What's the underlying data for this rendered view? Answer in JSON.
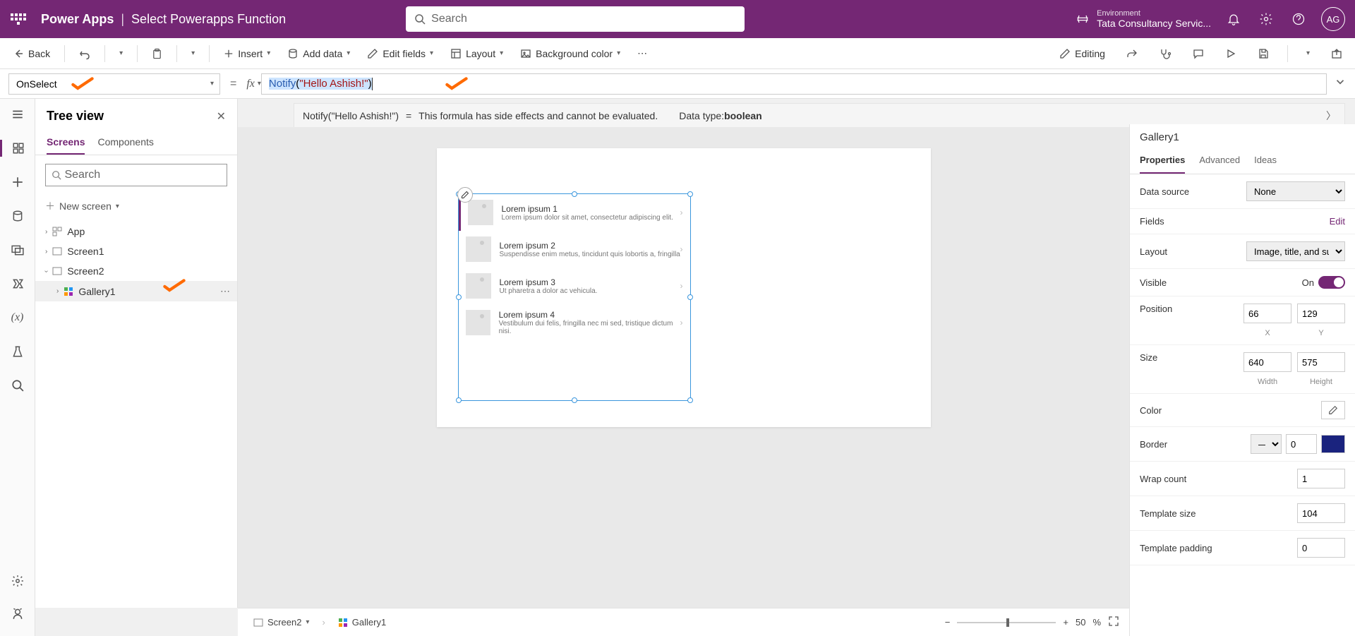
{
  "header": {
    "brand": "Power Apps",
    "title": "Select Powerapps Function",
    "search_placeholder": "Search",
    "env_label": "Environment",
    "env_value": "Tata Consultancy Servic...",
    "avatar": "AG"
  },
  "cmdbar": {
    "back": "Back",
    "insert": "Insert",
    "add_data": "Add data",
    "edit_fields": "Edit fields",
    "layout": "Layout",
    "bg_color": "Background color",
    "editing": "Editing"
  },
  "formula": {
    "property": "OnSelect",
    "fn": "Notify",
    "arg": "\"Hello Ashish!\"",
    "result_left": "Notify(\"Hello Ashish!\")",
    "result_eq": "=",
    "result_msg": "This formula has side effects and cannot be evaluated.",
    "datatype_label": "Data type: ",
    "datatype_value": "boolean"
  },
  "tree": {
    "title": "Tree view",
    "tab_screens": "Screens",
    "tab_components": "Components",
    "search_placeholder": "Search",
    "new_screen": "New screen",
    "app": "App",
    "screen1": "Screen1",
    "screen2": "Screen2",
    "gallery1": "Gallery1"
  },
  "gallery_rows": [
    {
      "title": "Lorem ipsum 1",
      "sub": "Lorem ipsum dolor sit amet, consectetur adipiscing elit."
    },
    {
      "title": "Lorem ipsum 2",
      "sub": "Suspendisse enim metus, tincidunt quis lobortis a, fringilla"
    },
    {
      "title": "Lorem ipsum 3",
      "sub": "Ut pharetra a dolor ac vehicula."
    },
    {
      "title": "Lorem ipsum 4",
      "sub": "Vestibulum dui felis, fringilla nec mi sed, tristique dictum nisi."
    }
  ],
  "props": {
    "name": "Gallery1",
    "tab_properties": "Properties",
    "tab_advanced": "Advanced",
    "tab_ideas": "Ideas",
    "data_source": "Data source",
    "data_source_value": "None",
    "fields": "Fields",
    "edit": "Edit",
    "layout": "Layout",
    "layout_value": "Image, title, and subtitle",
    "visible": "Visible",
    "visible_on": "On",
    "position": "Position",
    "pos_x": "66",
    "pos_y": "129",
    "x_label": "X",
    "y_label": "Y",
    "size": "Size",
    "size_w": "640",
    "size_h": "575",
    "w_label": "Width",
    "h_label": "Height",
    "color": "Color",
    "border": "Border",
    "border_value": "0",
    "wrap_count": "Wrap count",
    "wrap_value": "1",
    "template_size": "Template size",
    "template_size_value": "104",
    "template_padding": "Template padding",
    "template_padding_value": "0"
  },
  "bottom": {
    "screen": "Screen2",
    "gallery": "Gallery1",
    "zoom": "50",
    "pct": "%"
  }
}
